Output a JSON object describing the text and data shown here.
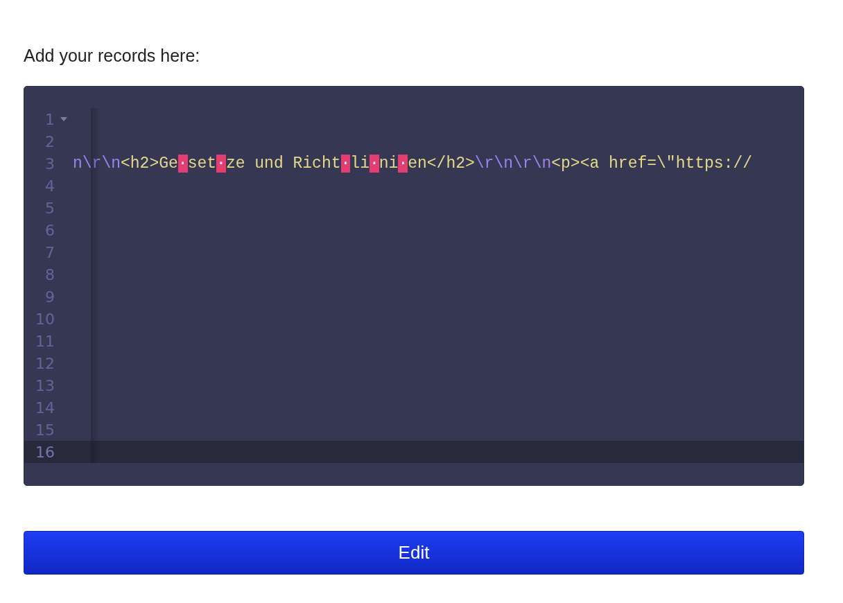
{
  "prompt": "Add your records here:",
  "editor": {
    "lines": [
      {
        "number": "1",
        "foldable": true,
        "active": false
      },
      {
        "number": "2",
        "foldable": false,
        "active": false
      },
      {
        "number": "3",
        "foldable": false,
        "active": false,
        "tokens": [
          {
            "kind": "escape",
            "text": "n\\r\\n"
          },
          {
            "kind": "text",
            "text": "<h2>Ge"
          },
          {
            "kind": "invisible",
            "text": "·"
          },
          {
            "kind": "text",
            "text": "set"
          },
          {
            "kind": "invisible",
            "text": "·"
          },
          {
            "kind": "text",
            "text": "ze und Richt"
          },
          {
            "kind": "invisible",
            "text": "·"
          },
          {
            "kind": "text",
            "text": "li"
          },
          {
            "kind": "invisible",
            "text": "·"
          },
          {
            "kind": "text",
            "text": "ni"
          },
          {
            "kind": "invisible",
            "text": "·"
          },
          {
            "kind": "text",
            "text": "en</h2>"
          },
          {
            "kind": "escape",
            "text": "\\r\\n\\r\\n"
          },
          {
            "kind": "text",
            "text": "<p><a href=\\\"https://"
          }
        ]
      },
      {
        "number": "4",
        "foldable": false,
        "active": false
      },
      {
        "number": "5",
        "foldable": false,
        "active": false
      },
      {
        "number": "6",
        "foldable": false,
        "active": false
      },
      {
        "number": "7",
        "foldable": false,
        "active": false
      },
      {
        "number": "8",
        "foldable": false,
        "active": false
      },
      {
        "number": "9",
        "foldable": false,
        "active": false
      },
      {
        "number": "10",
        "foldable": false,
        "active": false
      },
      {
        "number": "11",
        "foldable": false,
        "active": false
      },
      {
        "number": "12",
        "foldable": false,
        "active": false
      },
      {
        "number": "13",
        "foldable": false,
        "active": false
      },
      {
        "number": "14",
        "foldable": false,
        "active": false
      },
      {
        "number": "15",
        "foldable": false,
        "active": false
      },
      {
        "number": "16",
        "foldable": false,
        "active": true
      }
    ]
  },
  "button": {
    "label": "Edit"
  }
}
